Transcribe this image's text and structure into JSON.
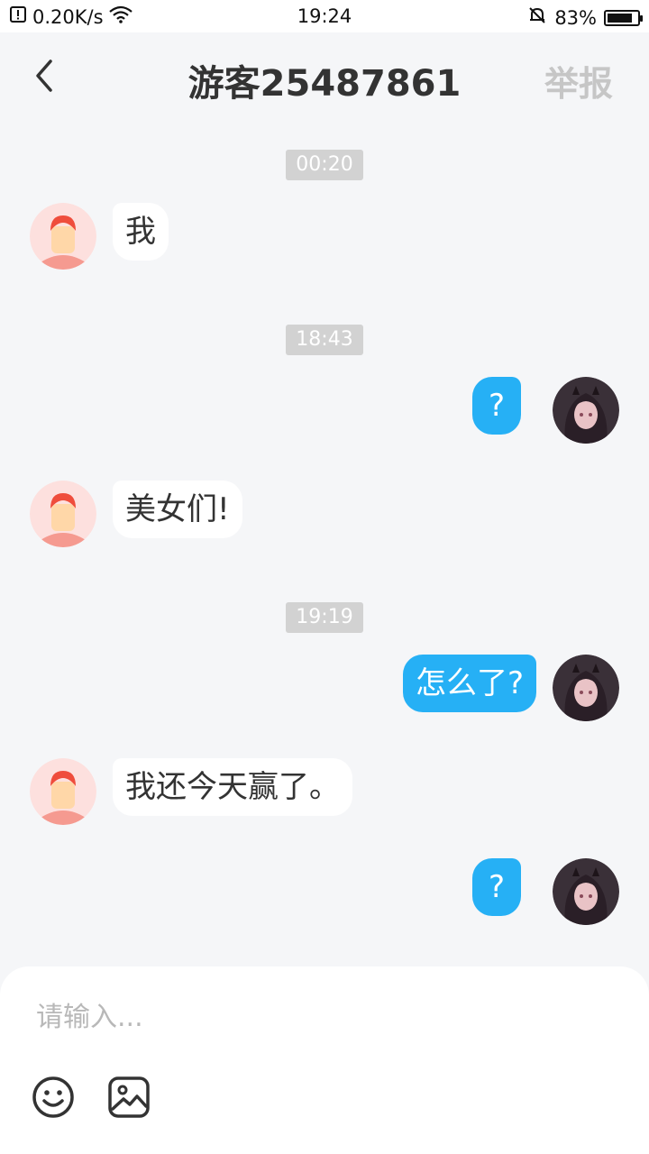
{
  "status_bar": {
    "net_speed": "0.20K/s",
    "time": "19:24",
    "battery_percent": "83%",
    "battery_level": 0.83,
    "icons": [
      "data-alert-icon",
      "wifi-icon",
      "bell-muted-icon",
      "battery-icon"
    ]
  },
  "header": {
    "title": "游客25487861",
    "report_label": "举报",
    "back_icon": "chevron-left-icon"
  },
  "messages": [
    {
      "type": "time",
      "text": "00:20"
    },
    {
      "type": "msg",
      "side": "in",
      "text": "我"
    },
    {
      "type": "time",
      "text": "18:43"
    },
    {
      "type": "msg",
      "side": "out",
      "text": "?"
    },
    {
      "type": "msg",
      "side": "in",
      "text": "美女们!"
    },
    {
      "type": "time",
      "text": "19:19"
    },
    {
      "type": "msg",
      "side": "out",
      "text": "怎么了?"
    },
    {
      "type": "msg",
      "side": "in",
      "text": "我还今天赢了。"
    },
    {
      "type": "msg",
      "side": "out",
      "text": "?"
    }
  ],
  "composer": {
    "placeholder": "请输入...",
    "value": "",
    "tools": [
      "emoji-icon",
      "image-icon"
    ]
  },
  "colors": {
    "background": "#f5f6f8",
    "outgoing_bubble": "#26b0f5",
    "incoming_bubble": "#ffffff",
    "time_chip": "#d2d2d2",
    "report_text": "#c6c6c6"
  }
}
